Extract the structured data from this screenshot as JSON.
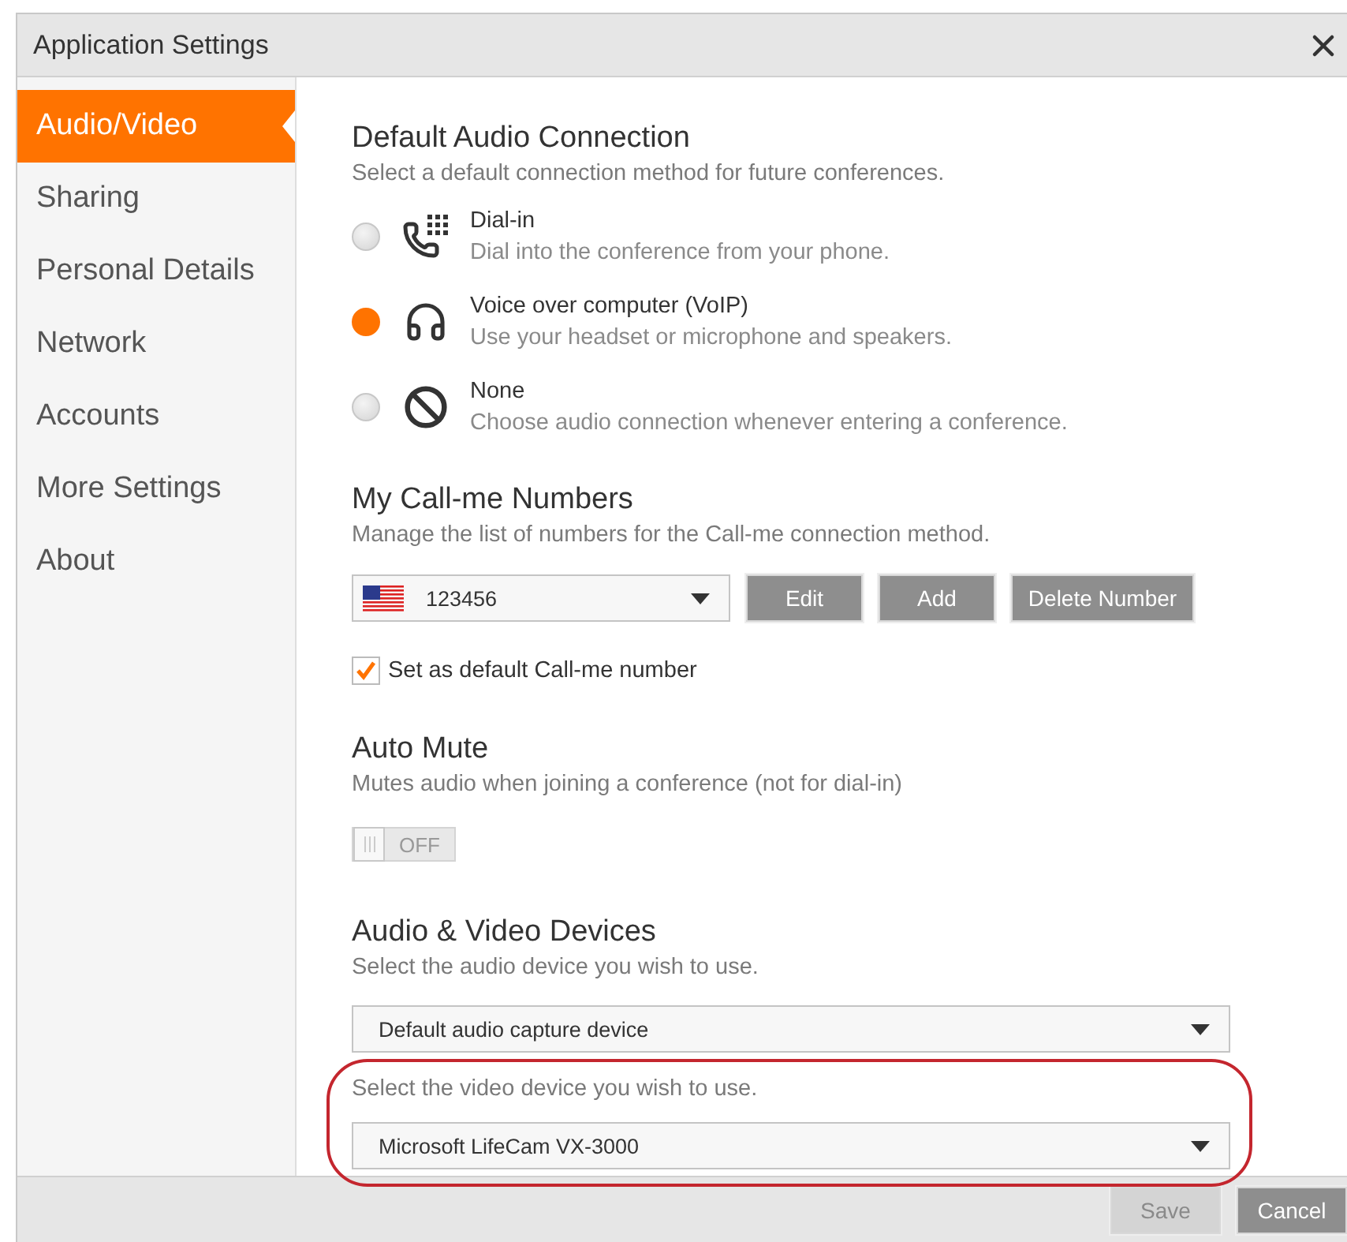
{
  "window": {
    "title": "Application Settings"
  },
  "sidebar": {
    "items": [
      {
        "label": "Audio/Video",
        "selected": true
      },
      {
        "label": "Sharing",
        "selected": false
      },
      {
        "label": "Personal Details",
        "selected": false
      },
      {
        "label": "Network",
        "selected": false
      },
      {
        "label": "Accounts",
        "selected": false
      },
      {
        "label": "More Settings",
        "selected": false
      },
      {
        "label": "About",
        "selected": false
      }
    ]
  },
  "audio_connection": {
    "heading": "Default Audio Connection",
    "subtitle": "Select a default connection method for future conferences.",
    "options": [
      {
        "kind": "dial",
        "title": "Dial-in",
        "description": "Dial into the conference from your phone.",
        "selected": false
      },
      {
        "kind": "voip",
        "title": "Voice over computer (VoIP)",
        "description": "Use your headset or microphone and speakers.",
        "selected": true
      },
      {
        "kind": "none",
        "title": "None",
        "description": "Choose audio connection whenever entering a conference.",
        "selected": false
      }
    ]
  },
  "call_me": {
    "heading": "My Call-me Numbers",
    "subtitle": "Manage the list of numbers for the Call-me connection method.",
    "number": "123456",
    "buttons": [
      "Edit",
      "Add",
      "Delete Number"
    ],
    "default_checkbox": {
      "label": "Set as default Call-me number",
      "checked": true
    }
  },
  "auto_mute": {
    "heading": "Auto Mute",
    "subtitle": "Mutes audio when joining a conference (not for dial-in)",
    "toggle": {
      "label": "OFF",
      "on": false
    }
  },
  "devices": {
    "heading": "Audio & Video Devices",
    "audio_prompt": "Select the audio device you wish to use.",
    "audio_device": "Default audio capture device",
    "video_prompt": "Select the video device you wish to use.",
    "video_device": "Microsoft LifeCam VX-3000",
    "video_highlighted": true
  },
  "footer": {
    "buttons": [
      {
        "label": "Save",
        "disabled": true
      },
      {
        "label": "Cancel",
        "disabled": false
      }
    ]
  }
}
